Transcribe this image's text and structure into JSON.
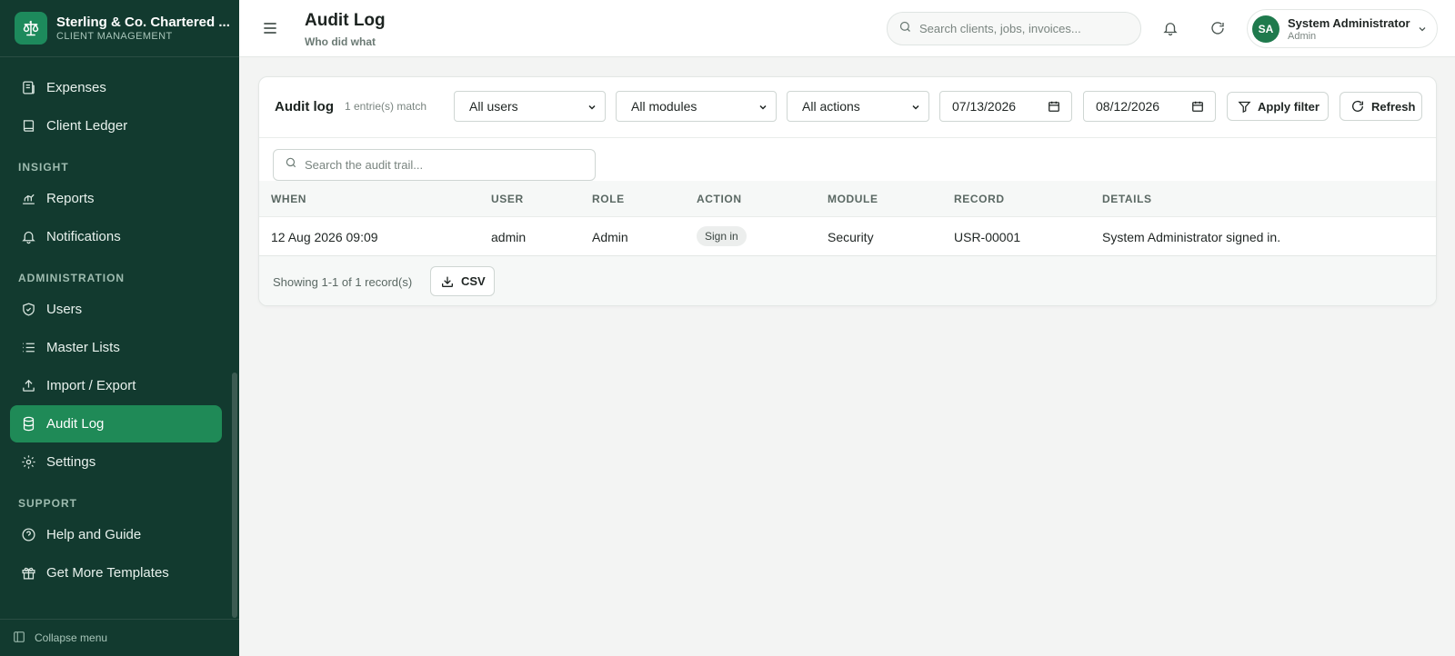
{
  "brand": {
    "name": "Sterling & Co. Chartered ...",
    "subtitle": "CLIENT MANAGEMENT"
  },
  "sidebar": {
    "items": [
      {
        "label": "Expenses",
        "icon": "receipt-icon"
      },
      {
        "label": "Client Ledger",
        "icon": "book-icon"
      },
      {
        "label": "Reports",
        "icon": "bar-chart-icon"
      },
      {
        "label": "Notifications",
        "icon": "bell-icon"
      },
      {
        "label": "Users",
        "icon": "shield-icon"
      },
      {
        "label": "Master Lists",
        "icon": "list-icon"
      },
      {
        "label": "Import / Export",
        "icon": "upload-icon"
      },
      {
        "label": "Audit Log",
        "icon": "database-icon",
        "active": true
      },
      {
        "label": "Settings",
        "icon": "gear-icon"
      },
      {
        "label": "Help and Guide",
        "icon": "help-circle-icon"
      },
      {
        "label": "Get More Templates",
        "icon": "gift-icon"
      }
    ],
    "sections": {
      "insight": "INSIGHT",
      "administration": "ADMINISTRATION",
      "support": "SUPPORT"
    },
    "collapse_label": "Collapse menu"
  },
  "header": {
    "title": "Audit Log",
    "subtitle": "Who did what",
    "search_placeholder": "Search clients, jobs, invoices...",
    "user": {
      "initials": "SA",
      "name": "System Administrator",
      "role": "Admin"
    }
  },
  "filters": {
    "title": "Audit log",
    "match_count": "1 entrie(s) match",
    "users": "All users",
    "modules": "All modules",
    "actions": "All actions",
    "date_from": "07/13/2026",
    "date_to": "08/12/2026",
    "apply_label": "Apply filter",
    "refresh_label": "Refresh",
    "trail_placeholder": "Search the audit trail..."
  },
  "table": {
    "columns": [
      "WHEN",
      "USER",
      "ROLE",
      "ACTION",
      "MODULE",
      "RECORD",
      "DETAILS"
    ],
    "rows": [
      {
        "when": "12 Aug 2026 09:09",
        "user": "admin",
        "role": "Admin",
        "action": "Sign in",
        "module": "Security",
        "record": "USR-00001",
        "details": "System Administrator signed in."
      }
    ]
  },
  "footer": {
    "showing": "Showing 1-1 of 1 record(s)",
    "csv_label": "CSV"
  },
  "colors": {
    "sidebar_bg": "#123a2f",
    "accent": "#1f8a57",
    "page_bg": "#f3f4f3"
  }
}
